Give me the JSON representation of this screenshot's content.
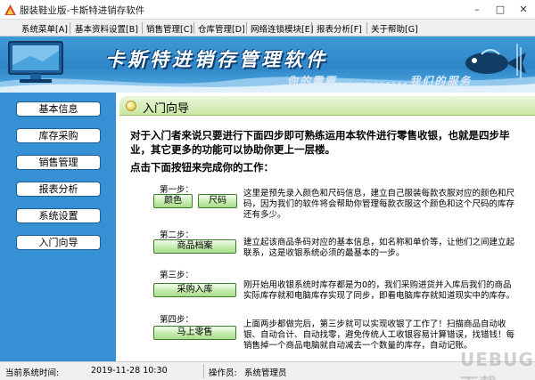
{
  "window": {
    "title": "服装鞋业版-卡斯特进销存软件",
    "controls": [
      "–",
      "□",
      "✕"
    ]
  },
  "menu": [
    "系统菜单[A]",
    "基本资料设置[B]",
    "销售管理[C]",
    "仓库管理[D]",
    "网络连锁模块[E]",
    "报表分析[F]",
    "关于帮助[G]"
  ],
  "banner": {
    "title": "卡斯特进销存管理软件",
    "slogan_left": "你的需要......",
    "slogan_right": "......我们的服务"
  },
  "sidebar": {
    "items": [
      "基本信息",
      "库存采购",
      "销售管理",
      "报表分析",
      "系统设置",
      "入门向导"
    ]
  },
  "panel": {
    "title": "入门向导",
    "intro": "对于入门者来说只要进行下面四步即可熟练运用本软件进行零售收银，也就是四步毕业，其它更多的功能可以协助你更上一层楼。",
    "call": "点击下面按钮来完成你的工作：",
    "steps": [
      {
        "label": "第一步：",
        "buttons": [
          "颜色",
          "尺码"
        ],
        "desc": "这里是预先录入颜色和尺码信息，建立自己服装每款衣服对应的颜色和尺码，因为我们的软件将会帮助你管理每款衣服这个颜色和这个尺码的库存还有多少。"
      },
      {
        "label": "第二步：",
        "buttons": [
          "商品档案"
        ],
        "desc": "建立起该商品条码对应的基本信息，如名称和单价等，让他们之间建立起联系，这是收银系统必须的最基本的一步。"
      },
      {
        "label": "第三步：",
        "buttons": [
          "采购入库"
        ],
        "desc": "刚开始用收银系统时库存都是为0的，我们采购进货并入库后我们的商品实际库存就和电脑库存实现了同步，即看电脑库存就知道现实中的库存。"
      },
      {
        "label": "第四步：",
        "buttons": [
          "马上零售"
        ],
        "desc": "上面两步都做完后，第三步就可以实现收银了工作了！扫描商品自动收银、自动合计、自动找零，避免传统人工收银容易计算错误，找错钱！每销售掉一个商品电脑就自动减去一个数量的库存，自动记账。"
      }
    ]
  },
  "status": {
    "time_label": "当前系统时间:",
    "time_value": "2019-11-28 10:30",
    "operator_label": "操作员:",
    "operator_value": "系统管理员"
  },
  "watermark": "UEBUG下载"
}
